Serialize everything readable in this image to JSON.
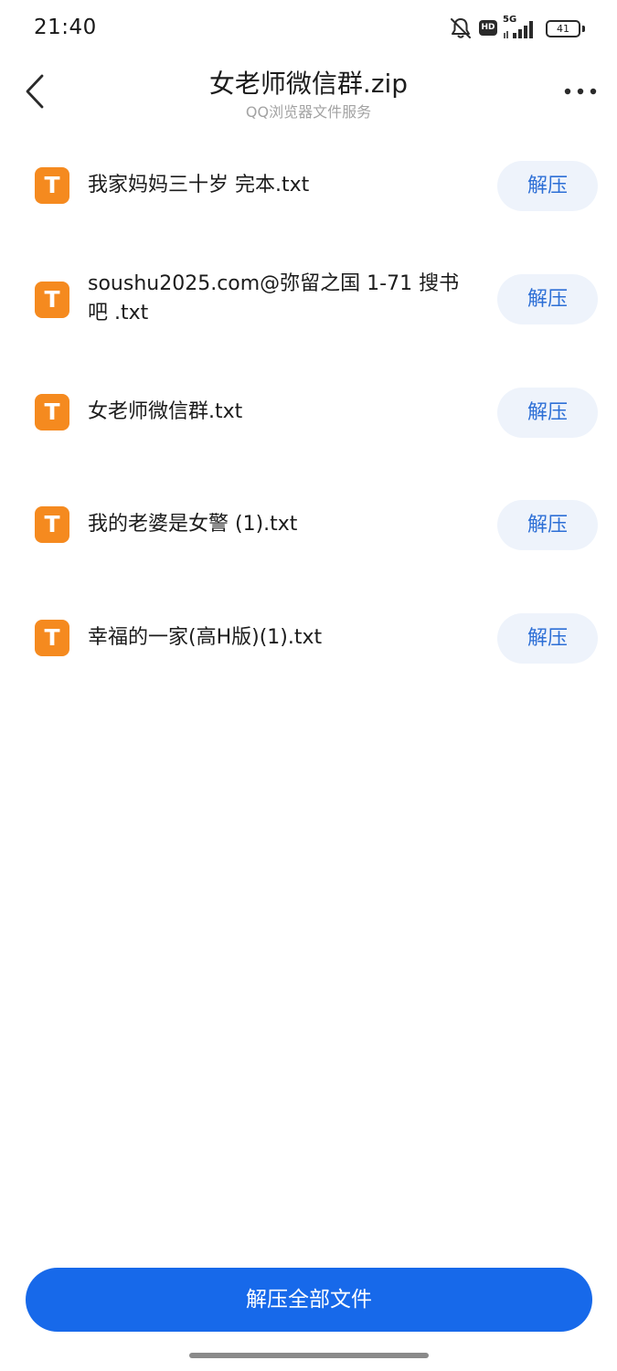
{
  "status_bar": {
    "time": "21:40",
    "network": "5G",
    "hd_label": "HD",
    "battery": "41",
    "icons": [
      "bell-muted-icon",
      "hd-icon",
      "signal-5g-icon",
      "battery-icon"
    ]
  },
  "header": {
    "title": "女老师微信群.zip",
    "subtitle": "QQ浏览器文件服务",
    "back_icon": "chevron-left-icon",
    "more_icon": "more-horizontal-icon"
  },
  "files": [
    {
      "name": " 我家妈妈三十岁 完本.txt",
      "action": "解压",
      "icon": "txt-file-icon",
      "icon_letter": "T"
    },
    {
      "name": "soushu2025.com@弥留之国 1-71 搜书吧 .txt",
      "action": "解压",
      "icon": "txt-file-icon",
      "icon_letter": "T"
    },
    {
      "name": "女老师微信群.txt",
      "action": "解压",
      "icon": "txt-file-icon",
      "icon_letter": "T"
    },
    {
      "name": "我的老婆是女警 (1).txt",
      "action": "解压",
      "icon": "txt-file-icon",
      "icon_letter": "T"
    },
    {
      "name": "幸福的一家(高H版)(1).txt",
      "action": "解压",
      "icon": "txt-file-icon",
      "icon_letter": "T"
    }
  ],
  "footer": {
    "extract_all_label": "解压全部文件"
  },
  "colors": {
    "accent": "#1769ea",
    "extract_button_bg": "#eef3fb",
    "extract_button_text": "#2d6fd6",
    "file_icon": "#f58a1f"
  }
}
